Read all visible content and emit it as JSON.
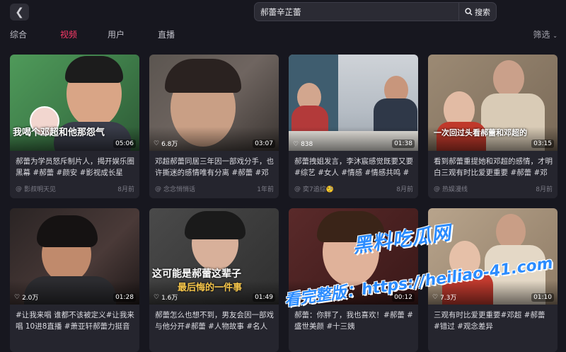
{
  "search": {
    "query": "郝蕾辛芷蕾",
    "button_label": "搜索"
  },
  "tabs": [
    "综合",
    "视频",
    "用户",
    "直播"
  ],
  "active_tab": "视频",
  "filter_label": "筛选",
  "cards": [
    {
      "title": "郝蕾为学员怒斥制片人，揭开娱乐圈黑幕 #郝蕾 #颜安 #影视成长星计...",
      "author": "影叔明天见",
      "age": "8月前",
      "likes": "",
      "duration": "05:06",
      "caption": "我喝个邓超和他那怨气"
    },
    {
      "title": "邓超郝蕾同居三年因一部戏分手，也许撕迷的感情唯有分离 #郝蕾 #邓超...",
      "author": "念念悄悄话",
      "age": "1年前",
      "likes": "6.8万",
      "duration": "03:07",
      "caption": ""
    },
    {
      "title": "郝蕾拽姐发言，李沐宸感觉既要又要 #综艺 #女人 #情感 #情感共鸣 #娱...",
      "author": "奕7追综🧐",
      "age": "8月前",
      "likes": "838",
      "duration": "01:38",
      "caption": ""
    },
    {
      "title": "看到郝蕾重提她和邓超的感情，才明白三观有时比爱更重要 #郝蕾 #邓超...",
      "author": "热娱漫线",
      "age": "8月前",
      "likes": "",
      "duration": "03:15",
      "caption": "一次回过头看郝蕾和邓超的"
    },
    {
      "title": "#让我来唱 谁都不该被定义#让我来唱 10进8直播 #萧亚轩郝蕾力挺音综关乎...",
      "author": "",
      "age": "",
      "likes": "2.0万",
      "duration": "01:28",
      "caption": ""
    },
    {
      "title": "郝蕾怎么也想不到，男友会因一部戏与他分开#郝蕾 #人物故事 #名人故事",
      "author": "",
      "age": "",
      "likes": "1.6万",
      "duration": "01:49",
      "caption": "这可能是郝蕾这辈子"
    },
    {
      "title": "郝蕾：你胖了，我也喜欢！#郝蕾 #盛世美颜 #十三姨",
      "author": "",
      "age": "",
      "likes": "4580",
      "duration": "00:12",
      "caption": ""
    },
    {
      "title": "三观有时比爱更重要#邓超 #郝蕾 #错过 #观念差异",
      "author": "",
      "age": "",
      "likes": "7.3万",
      "duration": "01:10",
      "caption": ""
    }
  ],
  "caption_extra": "最后悔的一件事",
  "watermark": {
    "logo": "黑料吃瓜网",
    "line": "看完整版：https://heiliao-41.com"
  }
}
